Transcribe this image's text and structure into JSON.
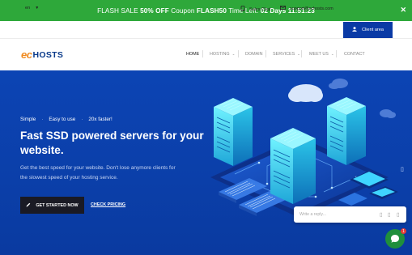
{
  "flash": {
    "text_pre": "FLASH SALE ",
    "discount": "50% OFF",
    "text_mid": " Coupon ",
    "coupon": "FLASH50",
    "text_time": " Time Left: ",
    "countdown": "02 Days 11:51:23",
    "close_glyph": "✕"
  },
  "util": {
    "language": "en",
    "sales_chat": "Sales Chat",
    "email": "support@echosts.com",
    "client_area": "Client area"
  },
  "logo": {
    "ec": "ec",
    "hosts": "HOSTS"
  },
  "nav": {
    "home": "HOME",
    "hosting": "HOSTING",
    "domain": "DOMAIN",
    "services": "SERVICES",
    "meet_us": "MEET US",
    "contact": "CONTACT"
  },
  "hero": {
    "tag1": "Simple",
    "tag2": "Easy to use",
    "tag3": "20x faster!",
    "headline": "Fast SSD powered servers for your website.",
    "desc": "Get the best speed for your website. Don't lose anymore clients for the slowest speed of your hosting service.",
    "btn_start": "GET STARTED NOW",
    "check_pricing": "CHECK PRICING"
  },
  "chat": {
    "placeholder": "Write a reply...",
    "badge": "1"
  },
  "colors": {
    "flash_bg": "#2ea83a",
    "brand_blue": "#0a3aa5",
    "hero_bg": "#0c44b4",
    "logo_orange": "#f08a1f",
    "server_cyan": "#3fe0f0",
    "chat_green": "#1f8f3c"
  }
}
